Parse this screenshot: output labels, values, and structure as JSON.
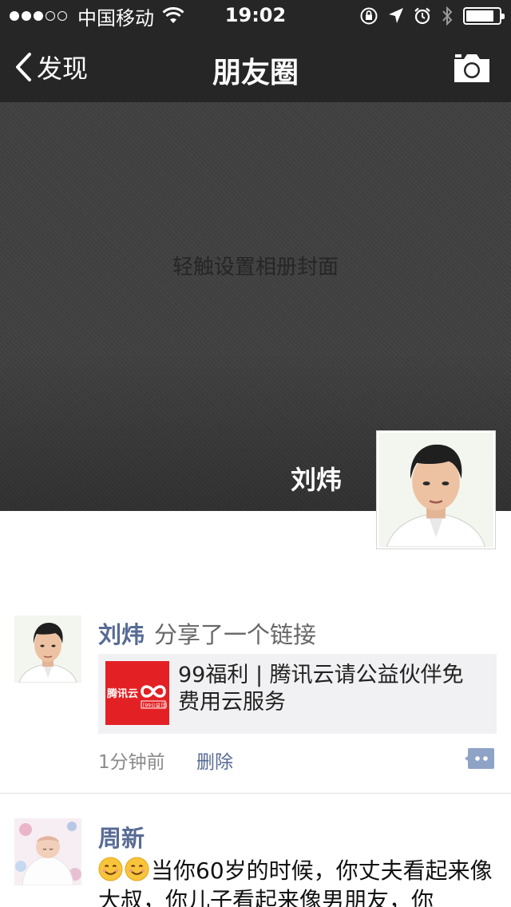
{
  "status_bar": {
    "carrier": "中国移动",
    "time": "19:02",
    "signal_bars_filled": 3,
    "signal_bars_total": 5,
    "battery_level": 0.7,
    "icons": [
      "wifi-icon",
      "rotation-lock-icon",
      "location-arrow-icon",
      "alarm-icon",
      "bluetooth-icon",
      "battery-icon"
    ]
  },
  "navbar": {
    "back_label": "发现",
    "title": "朋友圈",
    "right_icon": "camera-icon"
  },
  "cover": {
    "hint": "轻触设置相册封面",
    "user_name": "刘炜"
  },
  "feed": [
    {
      "author": "刘炜",
      "action": "分享了一个链接",
      "link": {
        "title": "99福利 | 腾讯云请公益伙伴免费用云服务",
        "thumb_text_brand": "腾讯云",
        "thumb_text_badge": "[99公益日]"
      },
      "time": "1分钟前",
      "delete_label": "删除"
    },
    {
      "author": "周新",
      "text": "当你60岁的时候，你丈夫看起来像大叔，你儿子看起来像男朋友，你"
    }
  ],
  "colors": {
    "nav_bg": "#262626",
    "name_link": "#576b95",
    "link_card_bg": "#f1f1f3",
    "brand_red": "#e32124"
  }
}
